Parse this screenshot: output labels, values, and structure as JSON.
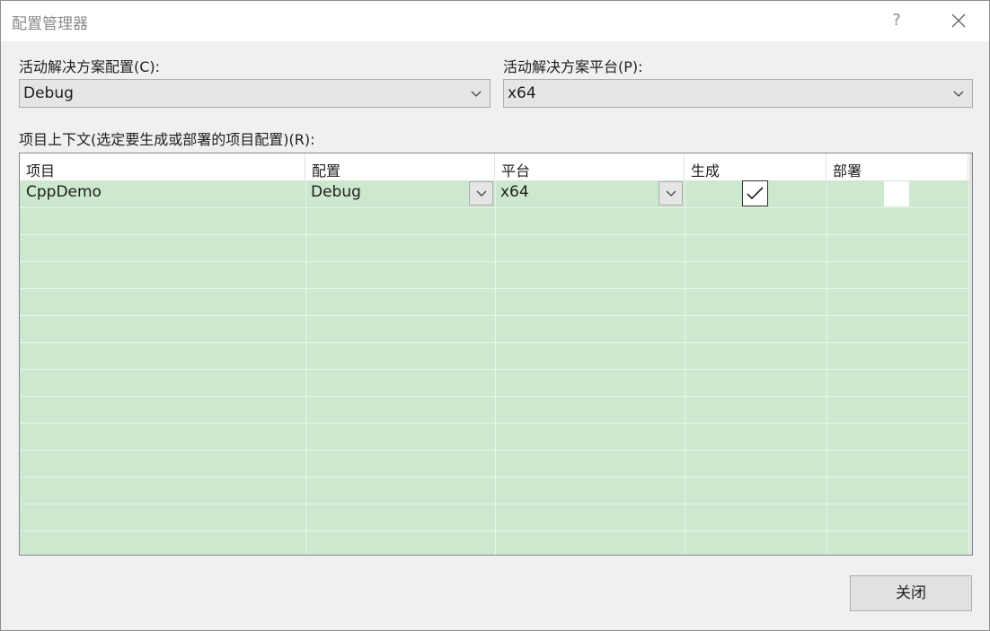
{
  "window": {
    "title": "配置管理器",
    "help_label": "?"
  },
  "active_config": {
    "label": "活动解决方案配置(C):",
    "value": "Debug"
  },
  "active_platform": {
    "label": "活动解决方案平台(P):",
    "value": "x64"
  },
  "project_contexts": {
    "label": "项目上下文(选定要生成或部署的项目配置)(R):",
    "columns": [
      "项目",
      "配置",
      "平台",
      "生成",
      "部署"
    ],
    "rows": [
      {
        "project": "CppDemo",
        "configuration": "Debug",
        "platform": "x64",
        "build": true,
        "deploy": false
      }
    ]
  },
  "footer": {
    "close_label": "关闭"
  },
  "colors": {
    "grid_row_bg": "#cce8cf",
    "header_bg": "#ffffff",
    "dialog_bg": "#f0f0f0"
  },
  "icons": {
    "help": "help-icon",
    "close": "close-icon",
    "dropdown": "chevron-down-icon",
    "check": "check-icon"
  }
}
